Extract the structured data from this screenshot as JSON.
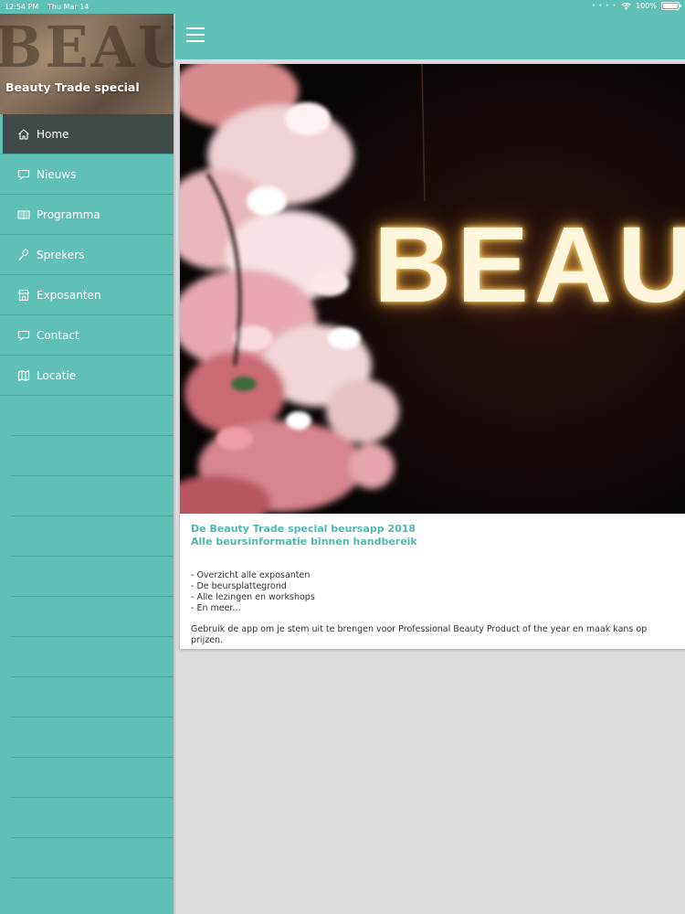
{
  "status_bar": {
    "time": "12:54 PM",
    "date": "Thu Mar 14",
    "battery": "100%"
  },
  "sidebar": {
    "title": "Beauty Trade special",
    "items": [
      {
        "label": "Home",
        "icon": "home-icon",
        "active": true
      },
      {
        "label": "Nieuws",
        "icon": "chat-bubble-icon"
      },
      {
        "label": "Programma",
        "icon": "book-icon"
      },
      {
        "label": "Sprekers",
        "icon": "microphone-icon"
      },
      {
        "label": "Exposanten",
        "icon": "storefront-icon"
      },
      {
        "label": "Contact",
        "icon": "chat-bubble-icon"
      },
      {
        "label": "Locatie",
        "icon": "map-icon"
      }
    ]
  },
  "card": {
    "hero_text": "BEAUTY",
    "heading_line1": "De Beauty Trade special beursapp 2018",
    "heading_line2": "Alle beursinformatie binnen handbereik",
    "list": [
      "- Overzicht alle exposanten",
      "- De beursplattegrond",
      "- Alle lezingen en workshops",
      "- En meer..."
    ],
    "paragraph": "Gebruik de app om je stem uit te brengen voor Professional Beauty Product of the year en maak kans op prijzen."
  },
  "colors": {
    "accent": "#5fc1b6",
    "active_nav": "#3f4a49",
    "heading": "#4fb8ac"
  }
}
